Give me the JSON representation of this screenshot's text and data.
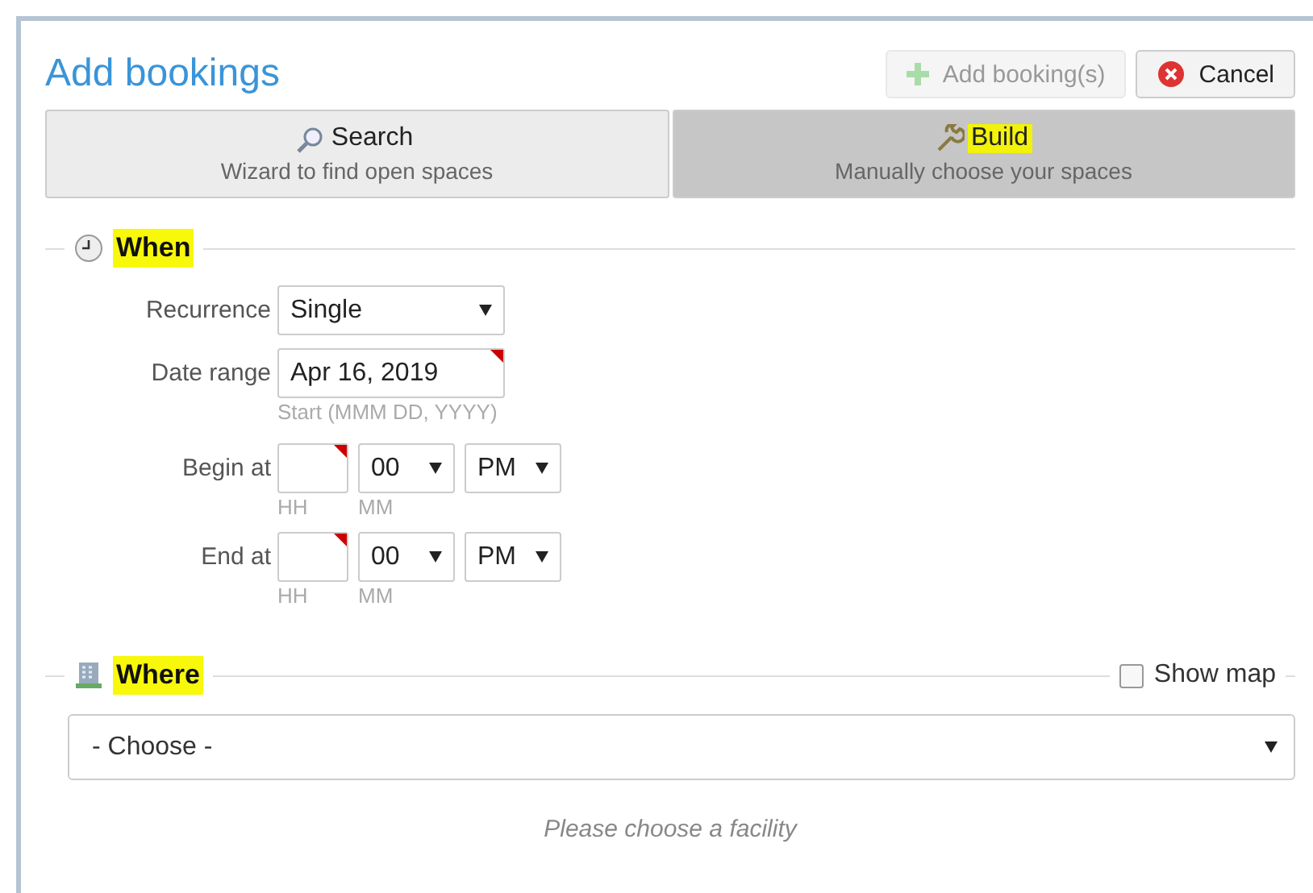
{
  "dialog": {
    "title": "Add bookings",
    "buttons": [
      {
        "kind": "add",
        "label": "Add booking(s)",
        "disabled": true
      },
      {
        "kind": "cancel",
        "label": "Cancel",
        "disabled": false
      }
    ]
  },
  "tabs": [
    {
      "kind": "search",
      "label": "Search",
      "sublabel": "Wizard to find open spaces",
      "selected": false,
      "highlighted": false
    },
    {
      "kind": "build",
      "label": "Build",
      "sublabel": "Manually choose your spaces",
      "selected": true,
      "highlighted": true
    }
  ],
  "when": {
    "title": "When",
    "highlighted": true,
    "recurrence": {
      "label": "Recurrence",
      "value": "Single"
    },
    "date_range": {
      "label": "Date range",
      "value": "Apr 16, 2019",
      "hint": "Start (MMM DD, YYYY)",
      "required": true
    },
    "times": [
      {
        "label": "Begin at",
        "hour_hint": "HH",
        "minute": "00",
        "minute_hint": "MM",
        "ampm": "PM",
        "required": true
      },
      {
        "label": "End at",
        "hour_hint": "HH",
        "minute": "00",
        "minute_hint": "MM",
        "ampm": "PM",
        "required": true
      }
    ]
  },
  "where": {
    "title": "Where",
    "highlighted": true,
    "show_map": {
      "label": "Show map",
      "checked": false
    },
    "facility": {
      "value": "- Choose -"
    },
    "message": "Please choose a facility"
  }
}
